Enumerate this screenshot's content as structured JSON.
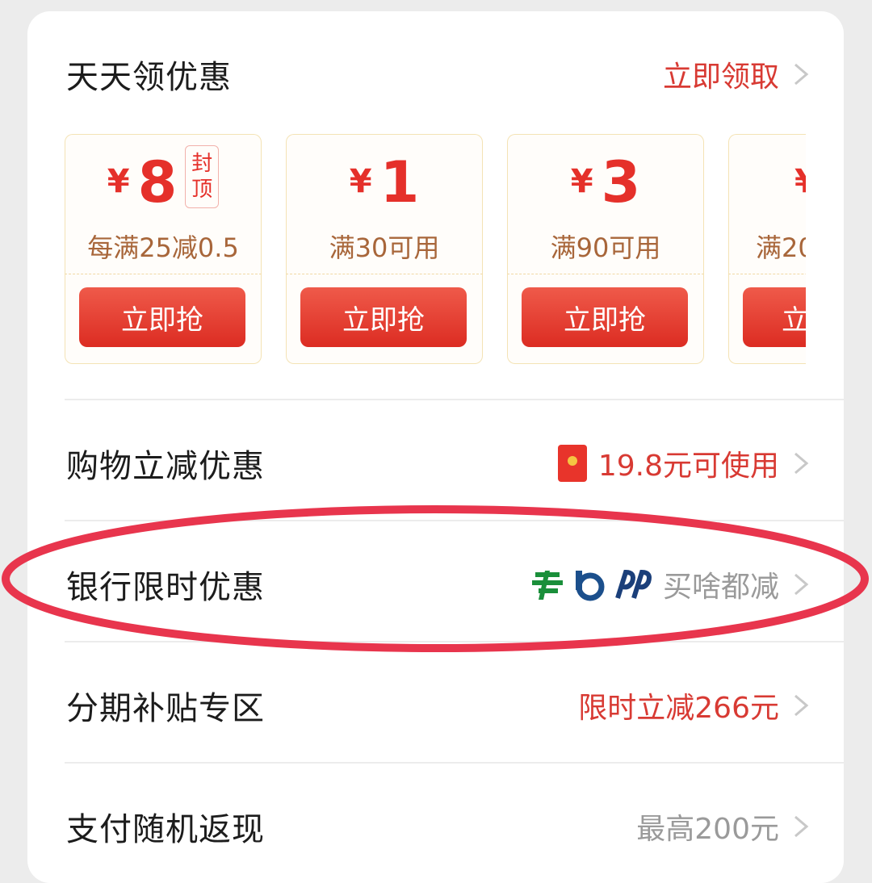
{
  "header": {
    "title": "天天领优惠",
    "action": "立即领取"
  },
  "coupons": [
    {
      "yen": "¥",
      "amount": "8",
      "badge_line1": "封",
      "badge_line2": "顶",
      "condition": "每满25减0.5",
      "button": "立即抢"
    },
    {
      "yen": "¥",
      "amount": "1",
      "condition": "满30可用",
      "button": "立即抢"
    },
    {
      "yen": "¥",
      "amount": "3",
      "condition": "满90可用",
      "button": "立即抢"
    },
    {
      "yen": "¥",
      "amount": "",
      "condition": "满20",
      "button": "立"
    }
  ],
  "rows": {
    "shopping": {
      "title": "购物立减优惠",
      "value": "19.8元可使用"
    },
    "bank": {
      "title": "银行限时优惠",
      "value": "买啥都减"
    },
    "installment": {
      "title": "分期补贴专区",
      "value": "限时立减266元"
    },
    "cashback": {
      "title": "支付随机返现",
      "value": "最高200元"
    }
  },
  "colors": {
    "accent_red": "#d83a33",
    "coupon_red": "#e5302a",
    "annotation_ring": "#e8354d"
  }
}
